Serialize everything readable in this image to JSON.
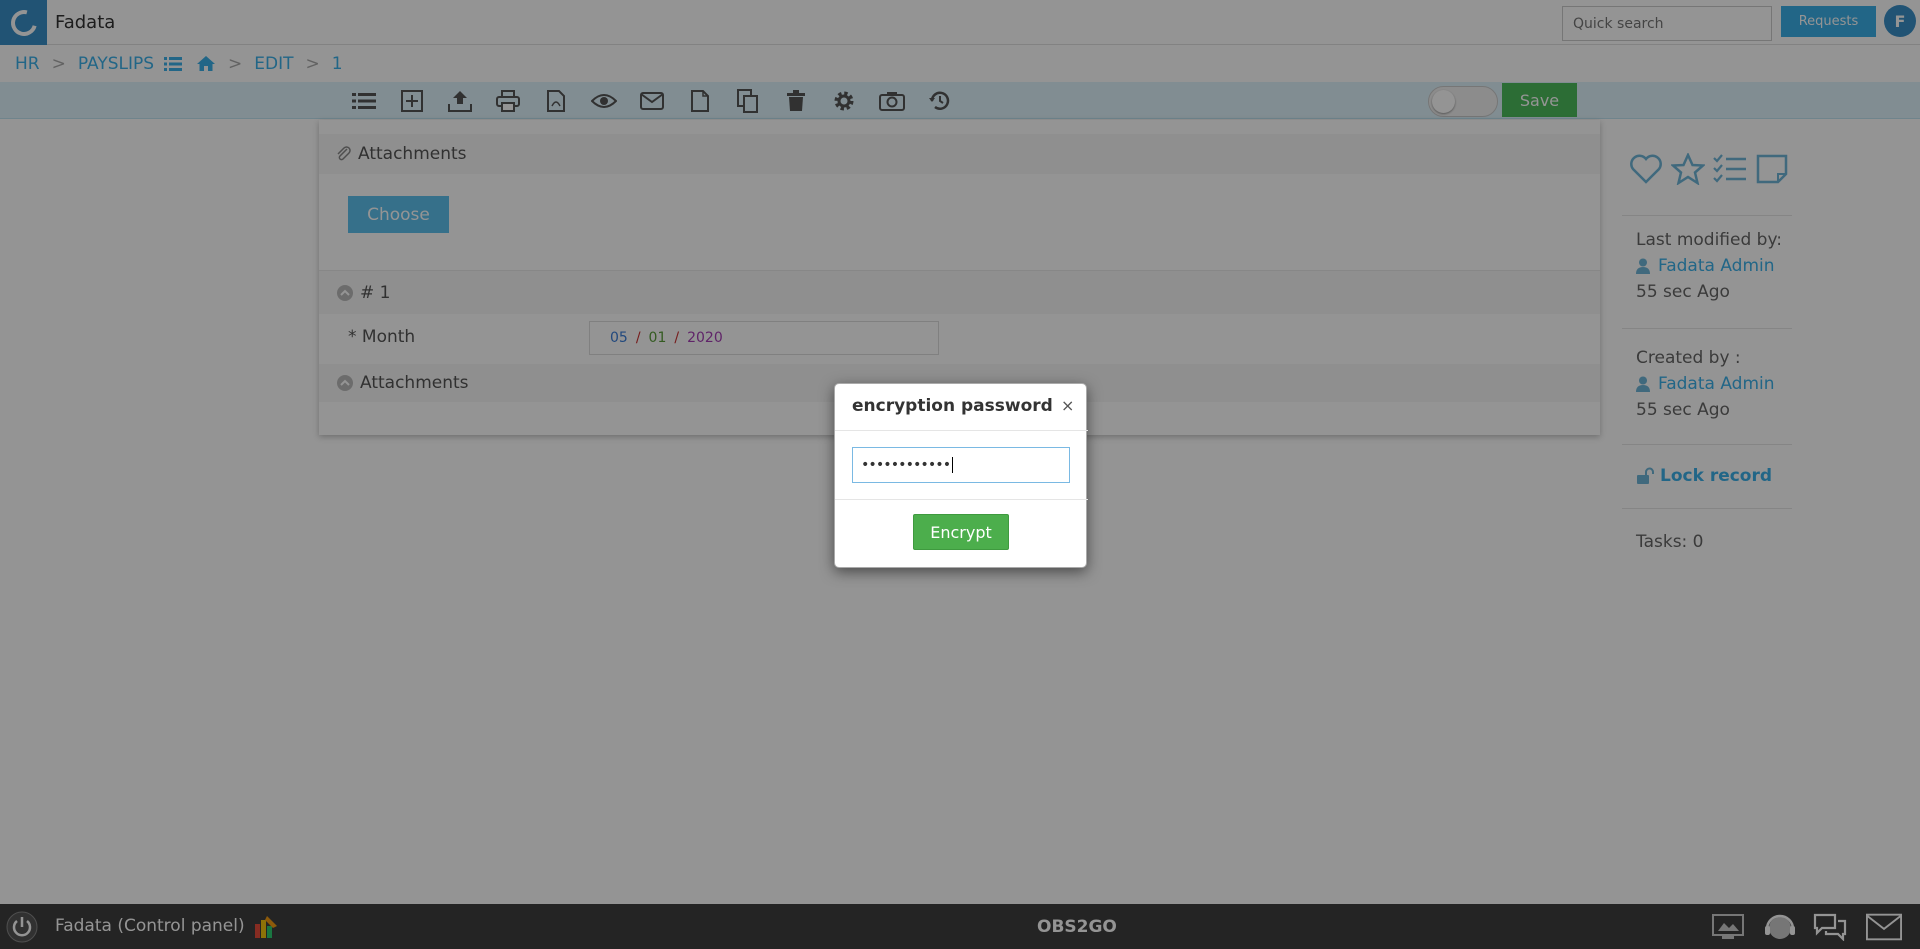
{
  "app": {
    "title": "Fadata",
    "logo_icon": "app-logo-icon"
  },
  "header": {
    "search_placeholder": "Quick search",
    "requests_label": "Requests",
    "user_initial": "F"
  },
  "breadcrumb": {
    "hr": "HR",
    "payslips": "PAYSLIPS",
    "edit": "EDIT",
    "record_id": "1",
    "separator": ">"
  },
  "toolbar": {
    "icons": [
      "list-icon",
      "add-icon",
      "upload-icon",
      "print-icon",
      "pdf-icon",
      "view-icon",
      "email-icon",
      "new-document-icon",
      "copy-icon",
      "delete-icon",
      "settings-icon",
      "camera-icon",
      "history-icon"
    ],
    "save_label": "Save"
  },
  "form": {
    "attachments_header": "Attachments",
    "choose_label": "Choose",
    "record_header": "# 1",
    "month_label": "* Month",
    "month_value": {
      "month": "05",
      "day": "01",
      "year": "2020",
      "sep": "/"
    },
    "attachments_header_2": "Attachments"
  },
  "sidebar": {
    "icons": [
      "heart-icon",
      "star-icon",
      "checklist-icon",
      "note-icon"
    ],
    "last_modified_label": "Last modified by:",
    "last_modified_user": "Fadata Admin",
    "last_modified_time": "55 sec Ago",
    "created_label": "Created by :",
    "created_user": "Fadata Admin",
    "created_time": "55 sec Ago",
    "lock_label": "Lock record",
    "tasks_label": "Tasks: 0"
  },
  "footer": {
    "control_panel": "Fadata (Control panel)",
    "center_label": "OBS2GO"
  },
  "modal": {
    "title": "encryption password",
    "close": "×",
    "password_value": "••••••••••••",
    "encrypt_label": "Encrypt"
  },
  "colors": {
    "accent": "#3bb0e8",
    "save_green": "#4cbc5c",
    "encrypt_green": "#4cae4c",
    "footer_bg": "#3f3f3f"
  }
}
